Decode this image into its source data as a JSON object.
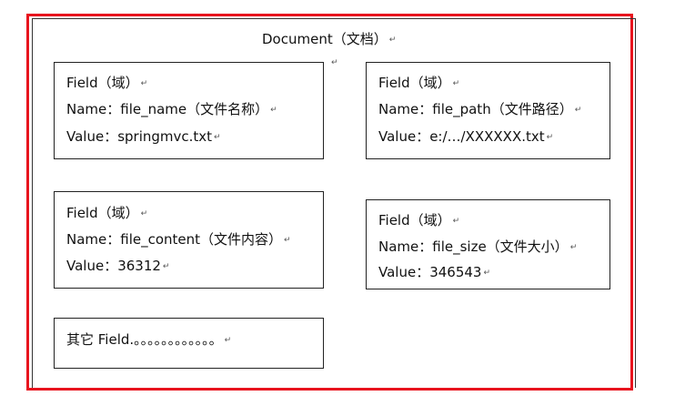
{
  "document": {
    "title": "Document（文档）",
    "para_mark": "↵"
  },
  "fields": [
    {
      "header": "Field（域）",
      "name": "Name：file_name（文件名称）",
      "value": "Value：springmvc.txt"
    },
    {
      "header": "Field（域）",
      "name": "Name：file_path（文件路径）",
      "value": "Value：e:/…/XXXXXX.txt"
    },
    {
      "header": "Field（域）",
      "name": "Name：file_content（文件内容）",
      "value": "Value：36312"
    },
    {
      "header": "Field（域）",
      "name": "Name：file_size（文件大小）",
      "value": "Value：346543"
    }
  ],
  "other": {
    "text": "其它 Field.。。。。。。。。。。。。"
  },
  "colors": {
    "outer_border": "#e8141e",
    "box_border": "#222222"
  }
}
